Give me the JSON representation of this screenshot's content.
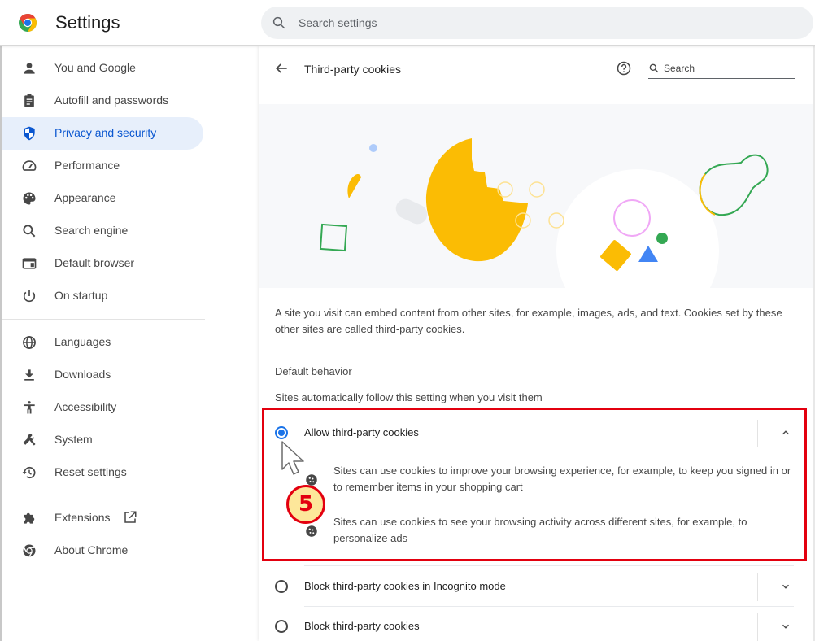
{
  "header": {
    "app_title": "Settings",
    "search_placeholder": "Search settings",
    "search_value": ""
  },
  "sidebar": {
    "items": [
      {
        "label": "You and Google",
        "icon": "person-icon"
      },
      {
        "label": "Autofill and passwords",
        "icon": "clipboard-icon"
      },
      {
        "label": "Privacy and security",
        "icon": "shield-icon",
        "active": true
      },
      {
        "label": "Performance",
        "icon": "speedometer-icon"
      },
      {
        "label": "Appearance",
        "icon": "palette-icon"
      },
      {
        "label": "Search engine",
        "icon": "search-icon"
      },
      {
        "label": "Default browser",
        "icon": "browser-window-icon"
      },
      {
        "label": "On startup",
        "icon": "power-icon"
      },
      {
        "label": "Languages",
        "icon": "globe-icon"
      },
      {
        "label": "Downloads",
        "icon": "download-icon"
      },
      {
        "label": "Accessibility",
        "icon": "accessibility-icon"
      },
      {
        "label": "System",
        "icon": "wrench-icon"
      },
      {
        "label": "Reset settings",
        "icon": "history-icon"
      },
      {
        "label": "Extensions",
        "icon": "puzzle-icon",
        "external": true
      },
      {
        "label": "About Chrome",
        "icon": "chrome-icon"
      }
    ]
  },
  "page": {
    "title": "Third-party cookies",
    "search_placeholder": "Search",
    "description": "A site you visit can embed content from other sites, for example, images, ads, and text. Cookies set by these other sites are called third-party cookies.",
    "section_title": "Default behavior",
    "section_subtitle": "Sites automatically follow this setting when you visit them",
    "options": [
      {
        "label": "Allow third-party cookies",
        "selected": true,
        "expanded": true,
        "bullets": [
          "Sites can use cookies to improve your browsing experience, for example, to keep you signed in or to remember items in your shopping cart",
          "Sites can use cookies to see your browsing activity across different sites, for example, to personalize ads"
        ]
      },
      {
        "label": "Block third-party cookies in Incognito mode",
        "selected": false,
        "expanded": false
      },
      {
        "label": "Block third-party cookies",
        "selected": false,
        "expanded": false
      }
    ]
  },
  "annotation": {
    "step_number": "5",
    "highlight_color": "#e3000f",
    "badge_fill": "#fde79a"
  },
  "colors": {
    "accent": "#1a73e8",
    "active_nav_bg": "#e7effb",
    "active_nav_text": "#0b57d0",
    "cookie_yellow": "#fbbc04",
    "google_green": "#34a853",
    "google_blue": "#4285f4"
  }
}
